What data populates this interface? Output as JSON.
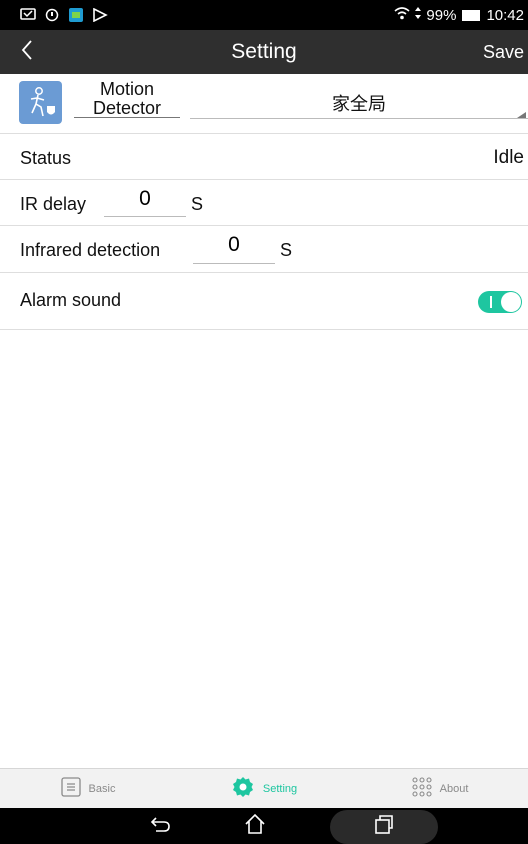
{
  "status_bar": {
    "battery": "99%",
    "time": "10:42"
  },
  "header": {
    "title": "Setting",
    "save_label": "Save"
  },
  "device": {
    "type": "Motion Detector",
    "name": "家全局"
  },
  "rows": {
    "status_label": "Status",
    "status_value": "Idle",
    "ir_delay_label": "IR delay",
    "ir_delay_value": "0",
    "ir_delay_unit": "S",
    "infrared_label": "Infrared detection",
    "infrared_value": "0",
    "infrared_unit": "S",
    "alarm_label": "Alarm sound",
    "alarm_on": true
  },
  "tabs": [
    {
      "label": "Basic",
      "icon": "document-icon",
      "active": false
    },
    {
      "label": "Setting",
      "icon": "gear-icon",
      "active": true
    },
    {
      "label": "About",
      "icon": "grid-dots-icon",
      "active": false
    }
  ],
  "colors": {
    "accent": "#1ec6a0",
    "titlebar": "#2f2f2f",
    "statusbar": "#000000",
    "device_icon_bg": "#6b9bd4"
  }
}
